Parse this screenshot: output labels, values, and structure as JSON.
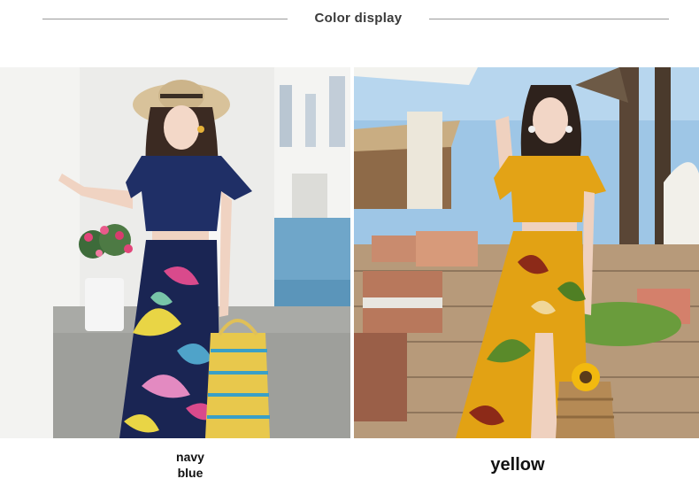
{
  "header": {
    "title": "Color display"
  },
  "variants": [
    {
      "label": "navy blue",
      "label_line1": "navy",
      "label_line2": "blue",
      "color": "#1c2a5c"
    },
    {
      "label": "yellow",
      "color": "#e3a316"
    }
  ]
}
